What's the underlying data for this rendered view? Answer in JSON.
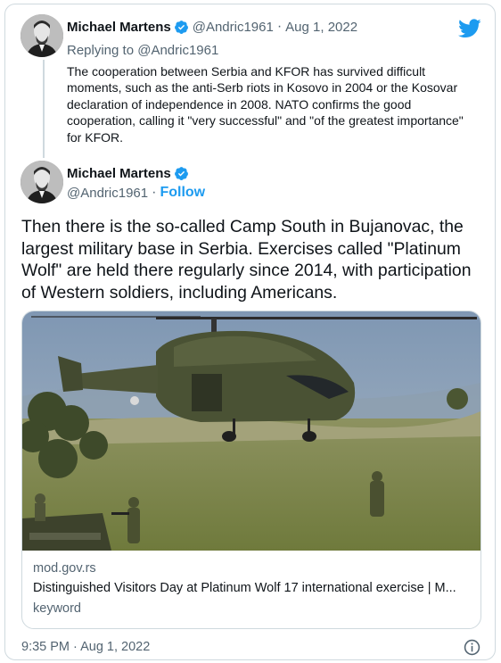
{
  "quoted_tweet": {
    "display_name": "Michael Martens",
    "handle": "@Andric1961",
    "separator": "·",
    "date": "Aug 1, 2022",
    "replying_to_prefix": "Replying to ",
    "replying_to_handle": "@Andric1961",
    "text": "The cooperation between Serbia and KFOR has survived difficult moments, such as the anti-Serb riots in Kosovo in 2004 or the Kosovar declaration of independence in 2008. NATO confirms the good cooperation, calling it \"very successful\" and \"of the greatest importance\" for KFOR."
  },
  "main_tweet": {
    "display_name": "Michael Martens",
    "handle": "@Andric1961",
    "separator": "·",
    "follow_label": "Follow",
    "text": "Then there is the so-called Camp South in Bujanovac, the largest military base in Serbia. Exercises called \"Platinum Wolf\" are held there regularly since 2014, with participation of Western soldiers, including Americans.",
    "timestamp": "9:35 PM · Aug 1, 2022"
  },
  "link_card": {
    "domain": "mod.gov.rs",
    "title": "Distinguished Visitors Day at Platinum Wolf 17 international exercise | M...",
    "description": "keyword"
  },
  "icons": {
    "twitter_logo": "twitter-bird-icon",
    "verified": "verified-badge-icon",
    "info": "info-icon"
  },
  "colors": {
    "accent": "#1d9bf0",
    "secondary_text": "#536471",
    "border": "#cfd9de"
  }
}
